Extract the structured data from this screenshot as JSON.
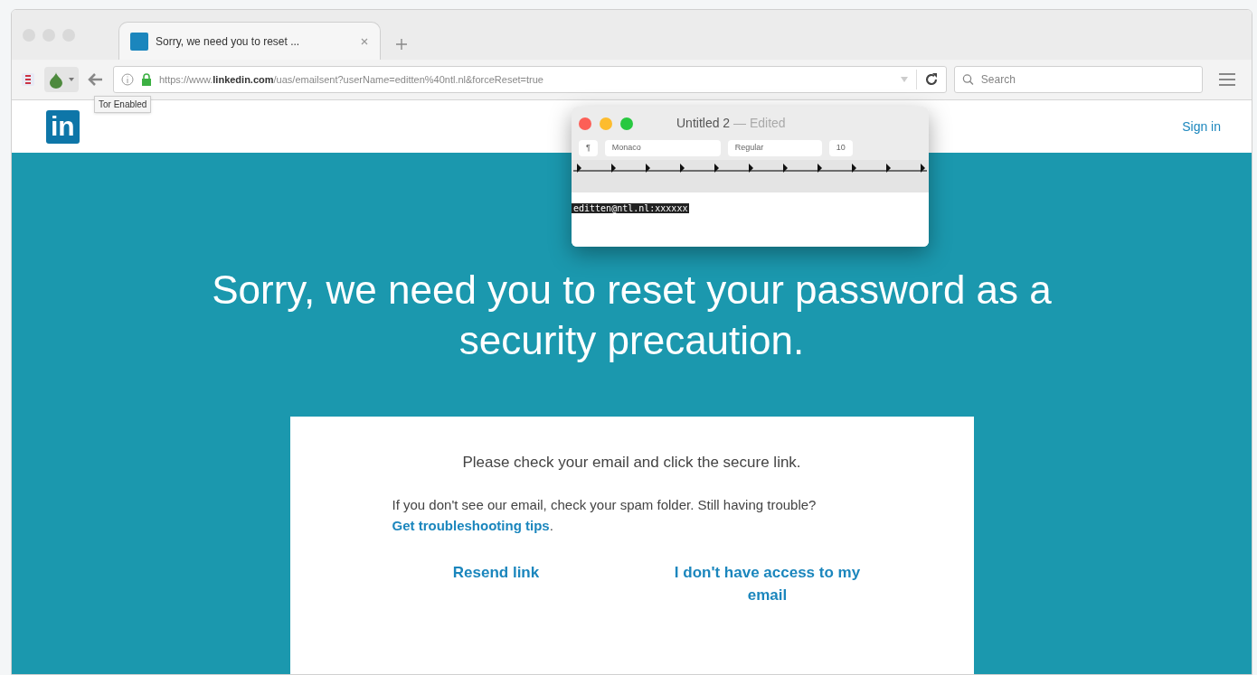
{
  "browser": {
    "tab": {
      "title": "Sorry, we need you to reset ...",
      "selected": true
    },
    "address": {
      "prefix": "https://www.",
      "domain": "linkedin.com",
      "path": "/uas/emailsent?userName=editten%40ntl.nl&forceReset=true"
    },
    "search": {
      "placeholder": "Search"
    },
    "tooltip": "Tor Enabled"
  },
  "page": {
    "logo": "in",
    "sign_in": "Sign in",
    "headline": "Sorry, we need you to reset your password as a security precaution.",
    "card": {
      "line1": "Please check your email and click the secure link.",
      "line2": "If you don't see our email, check your spam folder. Still having trouble?",
      "tips_link": "Get troubleshooting tips",
      "line2_end": ".",
      "actions": [
        "Resend link",
        "I don't have access to my email"
      ]
    }
  },
  "textedit": {
    "title": "Untitled 2",
    "status": "— Edited",
    "paragraph": "¶",
    "font": "Monaco",
    "style": "Regular",
    "size": "10",
    "selected_text": "editten@ntl.nl:xxxxxx"
  }
}
